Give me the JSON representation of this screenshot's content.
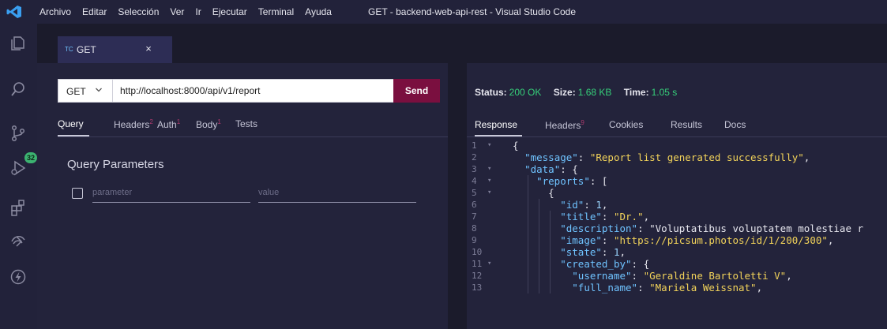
{
  "titlebar": {
    "menu": [
      "Archivo",
      "Editar",
      "Selección",
      "Ver",
      "Ir",
      "Ejecutar",
      "Terminal",
      "Ayuda"
    ],
    "window_title": "GET - backend-web-api-rest - Visual Studio Code"
  },
  "activity_bar": {
    "icons": [
      "explorer-icon",
      "search-icon",
      "source-control-icon",
      "run-debug-icon",
      "extensions-icon",
      "remote-icon",
      "thunder-client-icon"
    ],
    "scm_badge": "32"
  },
  "editor_tab": {
    "prefix": "TC",
    "label": "GET",
    "close": "×"
  },
  "request": {
    "method": "GET",
    "url": "http://localhost:8000/api/v1/report",
    "send_label": "Send",
    "tabs": [
      {
        "label": "Query",
        "count": ""
      },
      {
        "label": "Headers",
        "count": "2"
      },
      {
        "label": "Auth",
        "count": "1"
      },
      {
        "label": "Body",
        "count": "1"
      },
      {
        "label": "Tests",
        "count": ""
      }
    ],
    "active_tab": "Query",
    "query_title": "Query Parameters",
    "param_placeholder": "parameter",
    "value_placeholder": "value"
  },
  "response": {
    "status_label": "Status:",
    "status_value": "200 OK",
    "size_label": "Size:",
    "size_value": "1.68 KB",
    "time_label": "Time:",
    "time_value": "1.05 s",
    "tabs": [
      {
        "label": "Response",
        "count": ""
      },
      {
        "label": "Headers",
        "count": "9"
      },
      {
        "label": "Cookies",
        "count": ""
      },
      {
        "label": "Results",
        "count": ""
      },
      {
        "label": "Docs",
        "count": ""
      }
    ],
    "active_tab": "Response",
    "lines": [
      {
        "n": "1",
        "fold": true,
        "text": "{"
      },
      {
        "n": "2",
        "fold": false,
        "text": "  \"message\": \"Report list generated successfully\","
      },
      {
        "n": "3",
        "fold": true,
        "text": "  \"data\": {"
      },
      {
        "n": "4",
        "fold": true,
        "text": "    \"reports\": ["
      },
      {
        "n": "5",
        "fold": true,
        "text": "      {"
      },
      {
        "n": "6",
        "fold": false,
        "text": "        \"id\": 1,"
      },
      {
        "n": "7",
        "fold": false,
        "text": "        \"title\": \"Dr.\","
      },
      {
        "n": "8",
        "fold": false,
        "text": "        \"description\": \"Voluptatibus voluptatem molestiae r"
      },
      {
        "n": "9",
        "fold": false,
        "text": "        \"image\": \"https://picsum.photos/id/1/200/300\","
      },
      {
        "n": "10",
        "fold": false,
        "text": "        \"state\": 1,"
      },
      {
        "n": "11",
        "fold": true,
        "text": "        \"created_by\": {"
      },
      {
        "n": "12",
        "fold": false,
        "text": "          \"username\": \"Geraldine Bartoletti V\","
      },
      {
        "n": "13",
        "fold": false,
        "text": "          \"full_name\": \"Mariela Weissnat\","
      }
    ]
  },
  "colors": {
    "accent_send": "#7a0f3f",
    "status_ok": "#36d07a",
    "json_key": "#6fc3ff",
    "json_string": "#f2d35a"
  }
}
